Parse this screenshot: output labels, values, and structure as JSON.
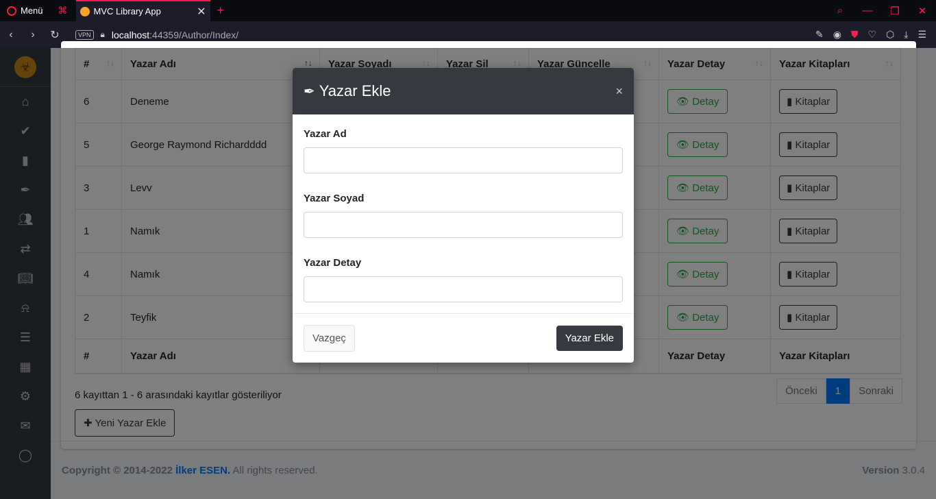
{
  "browser": {
    "menu_label": "Menü",
    "tab_title": "MVC Library App",
    "url_host": "localhost",
    "url_path": ":44359/Author/Index/",
    "vpn_label": "VPN"
  },
  "table": {
    "headers": [
      "#",
      "Yazar Adı",
      "Yazar Soyadı",
      "Yazar Sil",
      "Yazar Güncelle",
      "Yazar Detay",
      "Yazar Kitapları"
    ],
    "footer_headers": [
      "#",
      "Yazar Adı",
      "",
      "",
      "",
      "Yazar Detay",
      "Yazar Kitapları"
    ],
    "rows": [
      {
        "id": "6",
        "name": "Deneme"
      },
      {
        "id": "5",
        "name": "George Raymond Richardddd"
      },
      {
        "id": "3",
        "name": "Levv"
      },
      {
        "id": "1",
        "name": "Namık"
      },
      {
        "id": "4",
        "name": "Namık"
      },
      {
        "id": "2",
        "name": "Teyfik"
      }
    ],
    "detail_label": "Detay",
    "books_label": "Kitaplar"
  },
  "listing": {
    "info": "6 kayıttan 1 - 6 arasındaki kayıtlar gösteriliyor",
    "prev": "Önceki",
    "page": "1",
    "next": "Sonraki",
    "add_button": "Yeni Yazar Ekle"
  },
  "footer": {
    "copyright": "Copyright © 2014-2022",
    "author": "İlker ESEN.",
    "rights": "All rights reserved.",
    "version_label": "Version",
    "version": "3.0.4"
  },
  "modal": {
    "title": "Yazar Ekle",
    "close": "×",
    "fields": [
      {
        "label": "Yazar Ad",
        "value": ""
      },
      {
        "label": "Yazar Soyad",
        "value": ""
      },
      {
        "label": "Yazar Detay",
        "value": ""
      }
    ],
    "cancel": "Vazgeç",
    "submit": "Yazar Ekle"
  },
  "colors": {
    "sidebar": "#343a40",
    "accent": "#007bff",
    "success": "#28a745",
    "opera_red": "#ff1b4d"
  }
}
